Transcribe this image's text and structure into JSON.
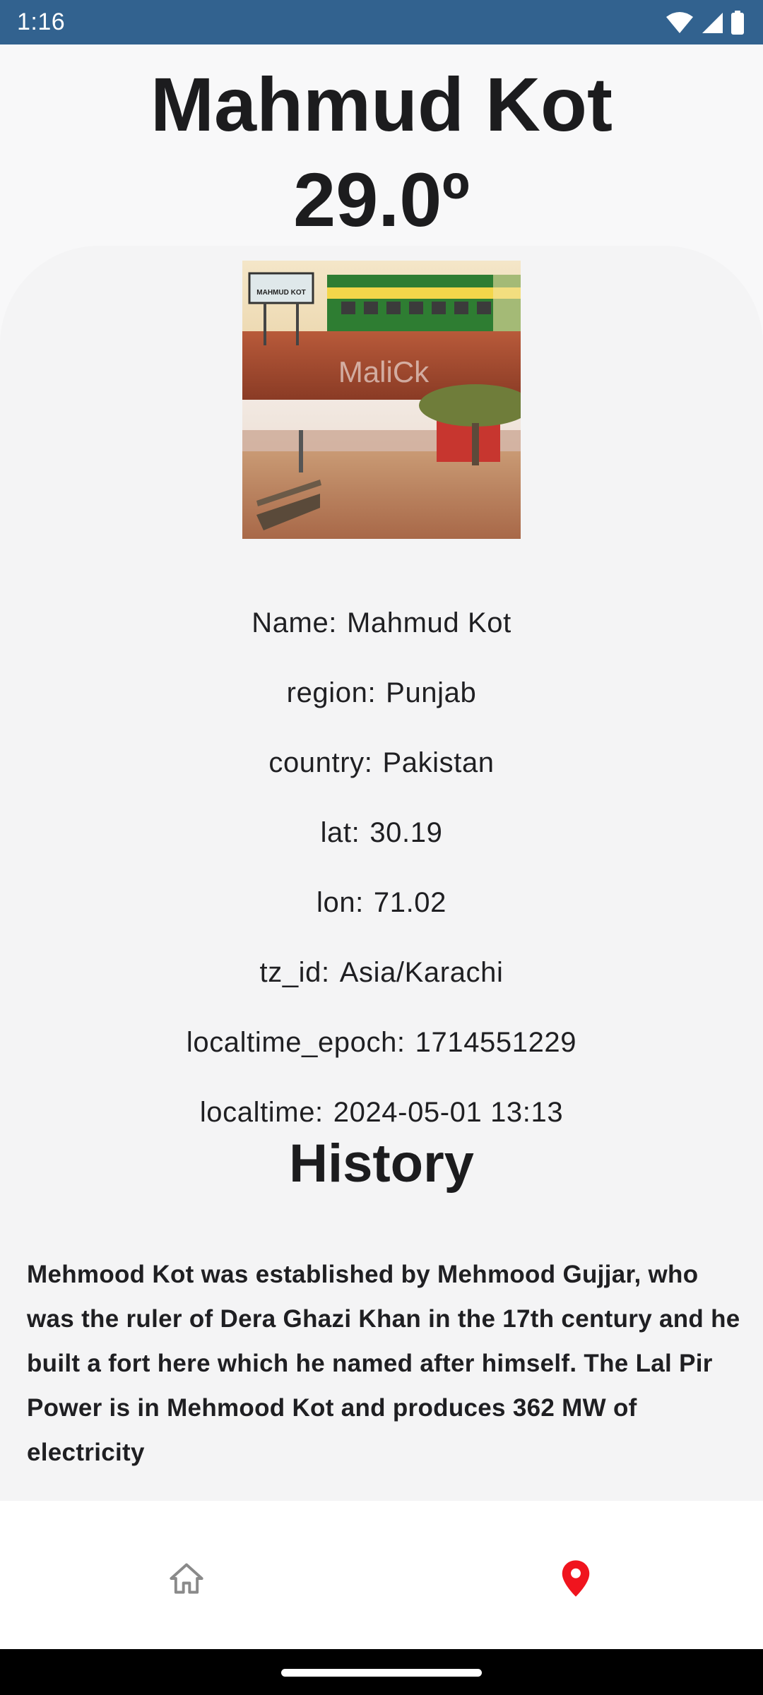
{
  "status_bar": {
    "time": "1:16"
  },
  "header": {
    "city": "Mahmud Kot",
    "temperature": "29.0º"
  },
  "photo": {
    "watermark": "MaliCk",
    "sign_text": "MAHMUD KOT"
  },
  "details": [
    {
      "label": "Name:",
      "value": "Mahmud Kot"
    },
    {
      "label": "region:",
      "value": "Punjab"
    },
    {
      "label": "country:",
      "value": "Pakistan"
    },
    {
      "label": "lat:",
      "value": "30.19"
    },
    {
      "label": "lon:",
      "value": "71.02"
    },
    {
      "label": "tz_id:",
      "value": "Asia/Karachi"
    },
    {
      "label": "localtime_epoch:",
      "value": "1714551229"
    },
    {
      "label": "localtime:",
      "value": "2024-05-01 13:13"
    }
  ],
  "history": {
    "title": "History",
    "text": "Mehmood Kot was established by Mehmood Gujjar, who was the ruler of Dera Ghazi Khan in the 17th century and he built a fort here which he named after himself. The Lal Pir Power is in Mehmood Kot and produces 362 MW of electricity"
  },
  "bottom_nav": {
    "items": [
      {
        "icon": "home-icon",
        "active": false
      },
      {
        "icon": "location-pin-icon",
        "active": true
      }
    ]
  },
  "colors": {
    "status_bar": "#32628f",
    "active_nav": "#f0141e",
    "inactive_nav": "#8a8a8a"
  }
}
